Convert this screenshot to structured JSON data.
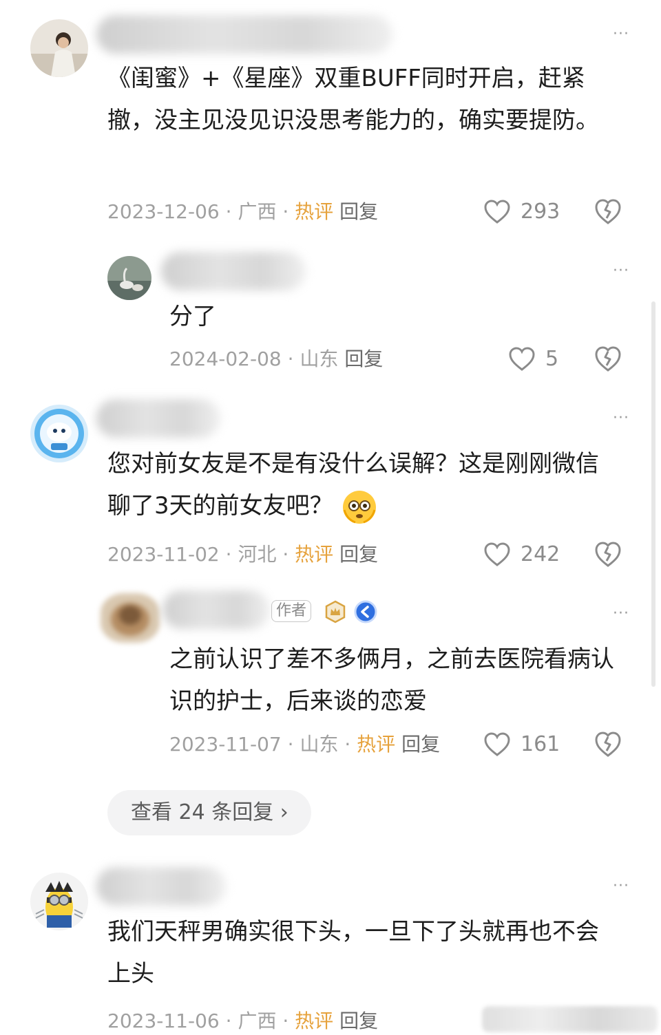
{
  "comments": [
    {
      "content": "《闺蜜》+《星座》双重BUFF同时开启，赶紧撤，没主见没见识没思考能力的，确实要提防。",
      "date": "2023-12-06",
      "sep1": " · ",
      "location": "广西",
      "sep2": " · ",
      "hot": "热评",
      "reply": "回复",
      "likes": "293"
    },
    {
      "content": "分了",
      "date": "2024-02-08",
      "sep1": " · ",
      "location": "山东",
      "reply": "回复",
      "likes": "5"
    },
    {
      "content": "您对前女友是不是有没什么误解？这是刚刚微信聊了3天的前女友吧？",
      "date": "2023-11-02",
      "sep1": " · ",
      "location": "河北",
      "sep2": " · ",
      "hot": "热评",
      "reply": "回复",
      "likes": "242"
    },
    {
      "author_tag": "作者",
      "content": "之前认识了差不多俩月，之前去医院看病认识的护士，后来谈的恋爱",
      "date": "2023-11-07",
      "sep1": " · ",
      "location": "山东",
      "sep2": " · ",
      "hot": "热评",
      "reply": "回复",
      "likes": "161"
    },
    {
      "content": "我们天秤男确实很下头，一旦下了头就再也不会上头",
      "date": "2023-11-06",
      "sep1": " · ",
      "location": "广西",
      "sep2": " · ",
      "hot": "热评",
      "reply": "回复"
    }
  ],
  "view_replies": "查看 24 条回复 ›",
  "more_glyph": "···",
  "colors": {
    "hot": "#e6a23c",
    "meta": "#a0a0a0",
    "pill_bg": "#f3f3f4"
  },
  "icons": [
    "heart-outline-icon",
    "broken-heart-icon",
    "more-icon",
    "flushed-emoji-icon",
    "crown-badge-icon",
    "blue-v-badge-icon"
  ]
}
